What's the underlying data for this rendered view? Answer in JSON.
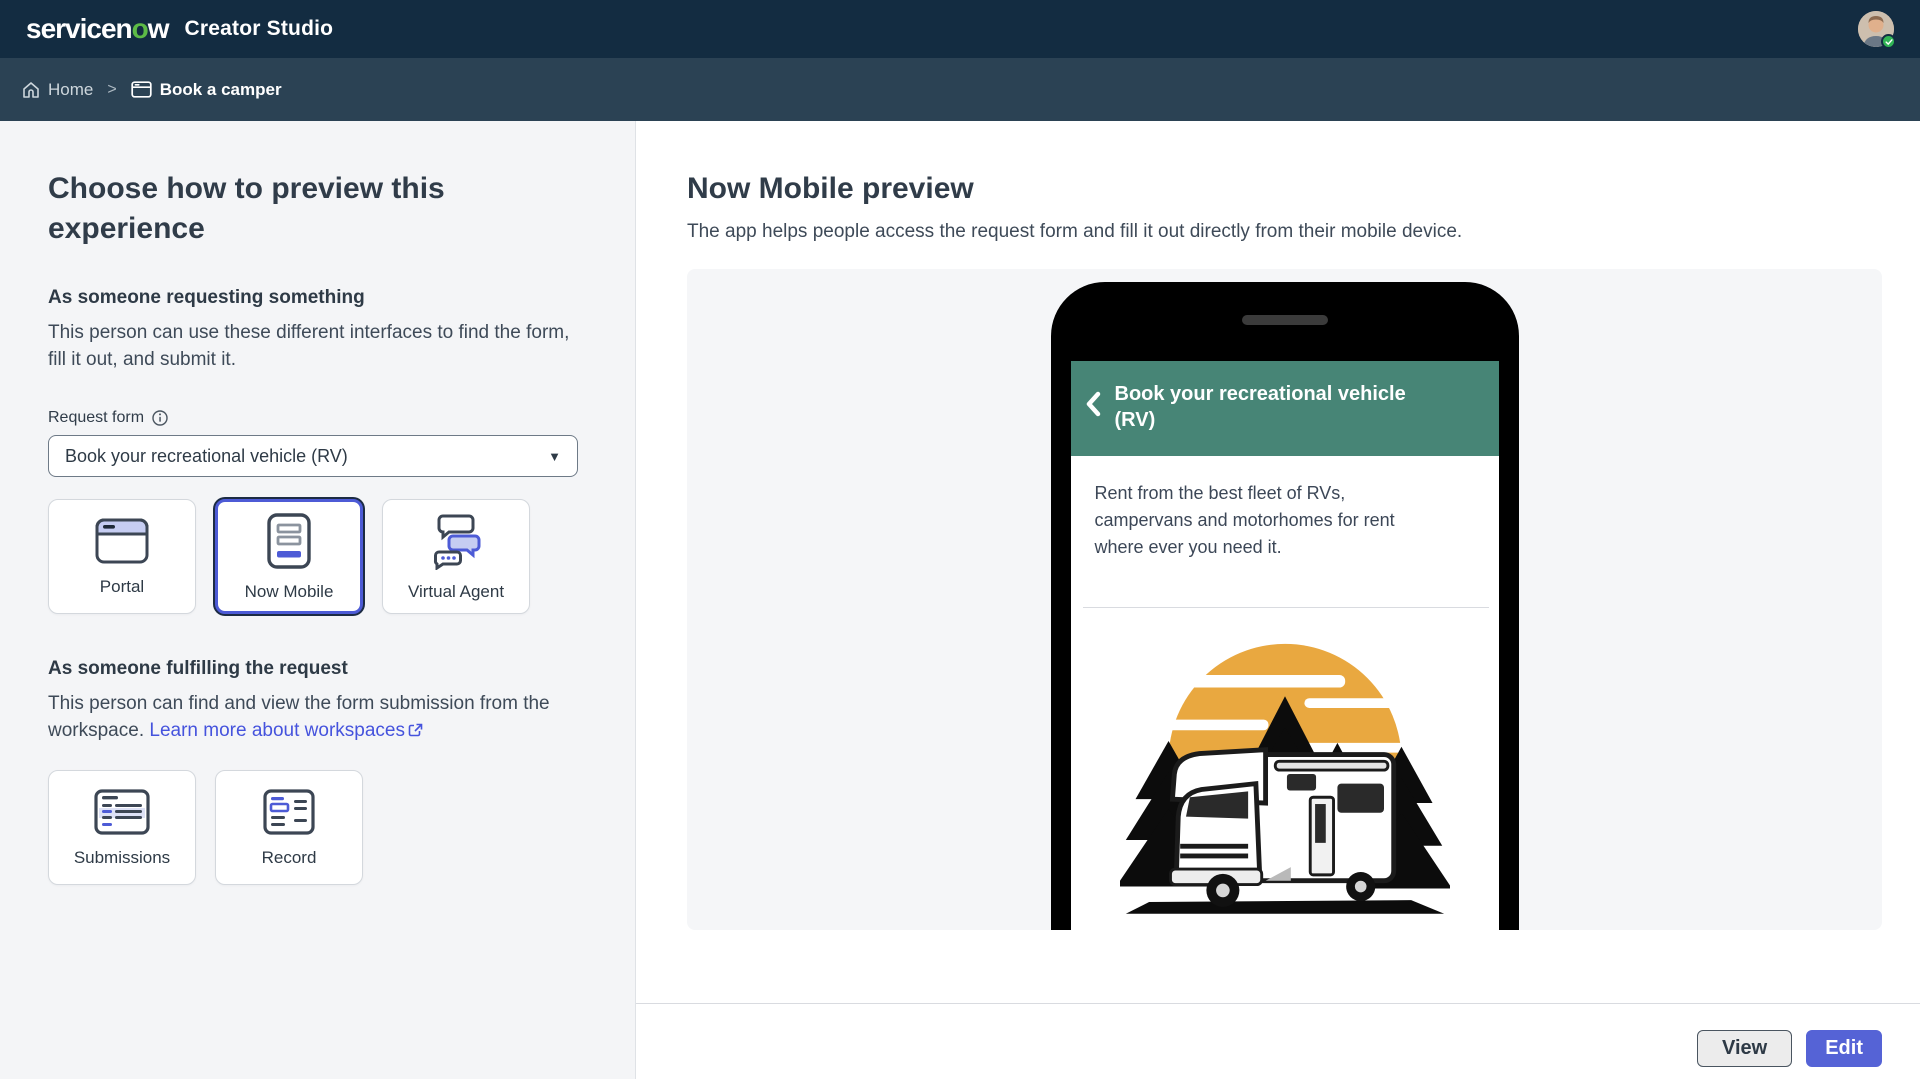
{
  "header": {
    "logo_part1": "servicen",
    "logo_part2": "o",
    "logo_part3": "w",
    "app_title": "Creator Studio"
  },
  "breadcrumb": {
    "home": "Home",
    "separator": ">",
    "current": "Book a camper"
  },
  "left_panel": {
    "title": "Choose how to preview this experience",
    "requesting": {
      "heading": "As someone requesting something",
      "description": "This person can use these different interfaces to find the form, fill it out, and submit it.",
      "request_form_label": "Request form",
      "request_form_value": "Book your recreational vehicle (RV)",
      "options": [
        {
          "label": "Portal",
          "selected": false
        },
        {
          "label": "Now Mobile",
          "selected": true
        },
        {
          "label": "Virtual Agent",
          "selected": false
        }
      ]
    },
    "fulfilling": {
      "heading": "As someone fulfilling the request",
      "description": "This person can find and view the form submission from the workspace.",
      "link_label": "Learn more about workspaces",
      "options": [
        {
          "label": "Submissions"
        },
        {
          "label": "Record"
        }
      ]
    }
  },
  "preview": {
    "title": "Now Mobile preview",
    "subtitle": "The app helps people access the request form and fill it out directly from their mobile device.",
    "phone": {
      "header_title": "Book your recreational vehicle (RV)",
      "description": "Rent from the best fleet of RVs, campervans and motorhomes for rent where ever you need it."
    }
  },
  "footer": {
    "view_label": "View",
    "edit_label": "Edit"
  },
  "colors": {
    "topbar_bg": "#132c41",
    "breadcrumb_bg": "#2b4254",
    "logo_green": "#5dbb46",
    "accent_indigo": "#4d5bd6",
    "edit_button": "#5563d6",
    "link_blue": "#4553dd",
    "phone_header_green": "#478576",
    "sun_orange": "#e9a840",
    "status_green": "#31b455"
  }
}
